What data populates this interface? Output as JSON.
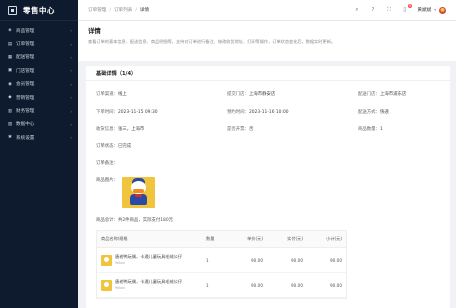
{
  "sidebar": {
    "title": "零售中心",
    "items": [
      {
        "icon": "tag-icon",
        "glyph": "◈",
        "label": "商品管理"
      },
      {
        "icon": "order-icon",
        "glyph": "▤",
        "label": "订单管理"
      },
      {
        "icon": "delivery-icon",
        "glyph": "▦",
        "label": "配送管理"
      },
      {
        "icon": "shop-icon",
        "glyph": "▣",
        "label": "门店管理"
      },
      {
        "icon": "member-icon",
        "glyph": "◉",
        "label": "会员管理"
      },
      {
        "icon": "marketing-icon",
        "glyph": "◆",
        "label": "营销管理"
      },
      {
        "icon": "finance-icon",
        "glyph": "▥",
        "label": "财务管理"
      },
      {
        "icon": "data-icon",
        "glyph": "▧",
        "label": "数据中心"
      },
      {
        "icon": "settings-icon",
        "glyph": "✱",
        "label": "系统设置"
      }
    ]
  },
  "header": {
    "breadcrumb": [
      "订单管理",
      "订单列表",
      "详情"
    ],
    "notifications": "9",
    "user": "黄斌斌"
  },
  "page": {
    "title": "详情",
    "description": "查看订单的基本信息、配送信息、商品明细等，支持对订单进行备注、修改收货地址、打印等操作，订单状态变化后，数据实时更新。"
  },
  "order": {
    "card_title": "基础详情（1/4）",
    "fields": [
      {
        "k": "订单渠道：",
        "v": "线上"
      },
      {
        "k": "提交门店：",
        "v": "上海市静安店"
      },
      {
        "k": "配送门店：",
        "v": "上海市浦东店"
      },
      {
        "k": "下单时间：",
        "v": "2023-11-15 09:30"
      },
      {
        "k": "预约时间：",
        "v": "2023-11-16 10:00"
      },
      {
        "k": "配送方式：",
        "v": "快递"
      },
      {
        "k": "收货信息：",
        "v": "张三，上海市"
      },
      {
        "k": "是否开票：",
        "v": "否"
      },
      {
        "k": "商品数量：",
        "v": "1"
      }
    ],
    "status": "订单状态：已完成",
    "remark": "订单备注：",
    "image_label": "商品图片：",
    "summary": "商品总计：共2件商品，实际支付180元",
    "columns": [
      "商品名称/规格",
      "数量",
      "单价(元)",
      "实付(元)",
      "小计(元)"
    ],
    "rows": [
      {
        "name": "唐老鸭玩偶，卡通儿童玩具毛绒公仔",
        "sub": "Yellow",
        "qty": "1",
        "price": "90.00",
        "paid": "90.00",
        "total": "90.00"
      },
      {
        "name": "唐老鸭玩偶，卡通儿童玩具毛绒公仔",
        "sub": "Yellow",
        "qty": "1",
        "price": "90.00",
        "paid": "90.00",
        "total": "90.00"
      }
    ]
  }
}
